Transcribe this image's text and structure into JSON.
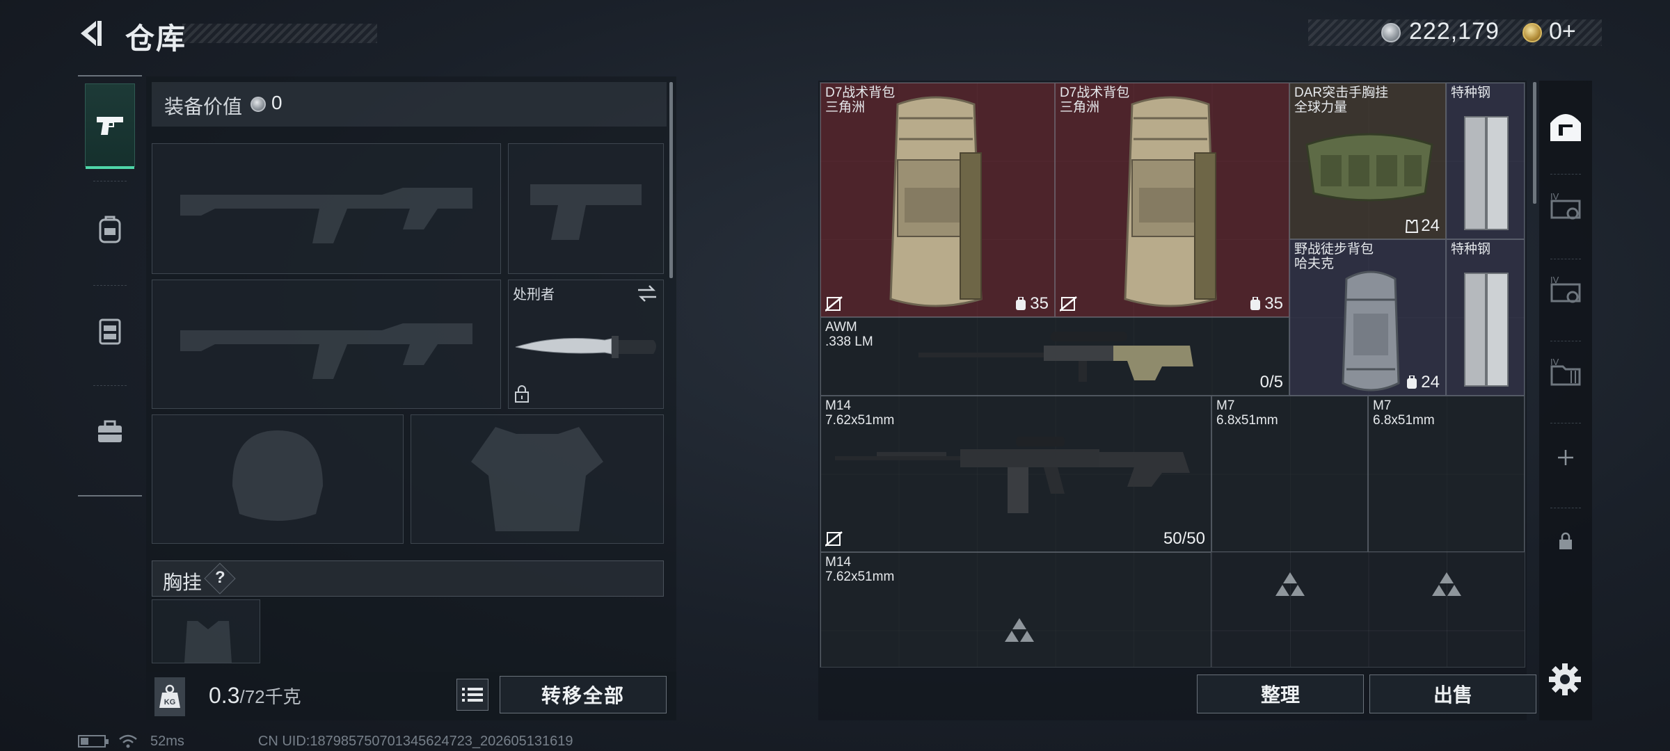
{
  "header": {
    "title": "仓库"
  },
  "currency": {
    "silver": "222,179",
    "gold": "0+"
  },
  "loadout": {
    "equip_value_label": "装备价值",
    "equip_value": "0",
    "melee_name": "处刑者",
    "chest_label": "胸挂",
    "chest_help": "?"
  },
  "weight": {
    "current": "0.3",
    "max": "/72千克"
  },
  "buttons": {
    "transfer_all": "转移全部",
    "sort": "整理",
    "sell": "出售"
  },
  "status": {
    "ping": "52ms",
    "uid": "CN UID:187985750701345624723_202605131619",
    "battery_level": 0.35
  },
  "stash": {
    "items": [
      {
        "name": "D7战术背包",
        "sub": "三角洲",
        "count": "35"
      },
      {
        "name": "D7战术背包",
        "sub": "三角洲",
        "count": "35"
      },
      {
        "name": "DAR突击手胸挂",
        "sub": "全球力量",
        "count": "24"
      },
      {
        "name": "特种钢",
        "sub": ""
      },
      {
        "name": "野战徒步背包",
        "sub": "哈夫克",
        "count": "24"
      },
      {
        "name": "特种钢",
        "sub": ""
      },
      {
        "name": "AWM",
        "sub": ".338 LM",
        "count": "0/5"
      },
      {
        "name": "M14",
        "sub": "7.62x51mm",
        "count": "50/50"
      },
      {
        "name": "M7",
        "sub": "6.8x51mm"
      },
      {
        "name": "M7",
        "sub": "6.8x51mm"
      },
      {
        "name": "M14",
        "sub": "7.62x51mm"
      }
    ]
  },
  "colors": {
    "accent": "#4fd6a8",
    "red_bg": "#6c262e"
  },
  "icons": {
    "back": "back-arrow-icon",
    "tabs": [
      "pistol-icon",
      "backpack-icon",
      "vest-icon",
      "toolbox-icon"
    ],
    "right_rail": [
      "stash-icon",
      "stash-tab-iv-icon",
      "stash-tab-iv-icon",
      "stash-tab-iv-icon",
      "plus-icon",
      "lock-icon"
    ]
  }
}
